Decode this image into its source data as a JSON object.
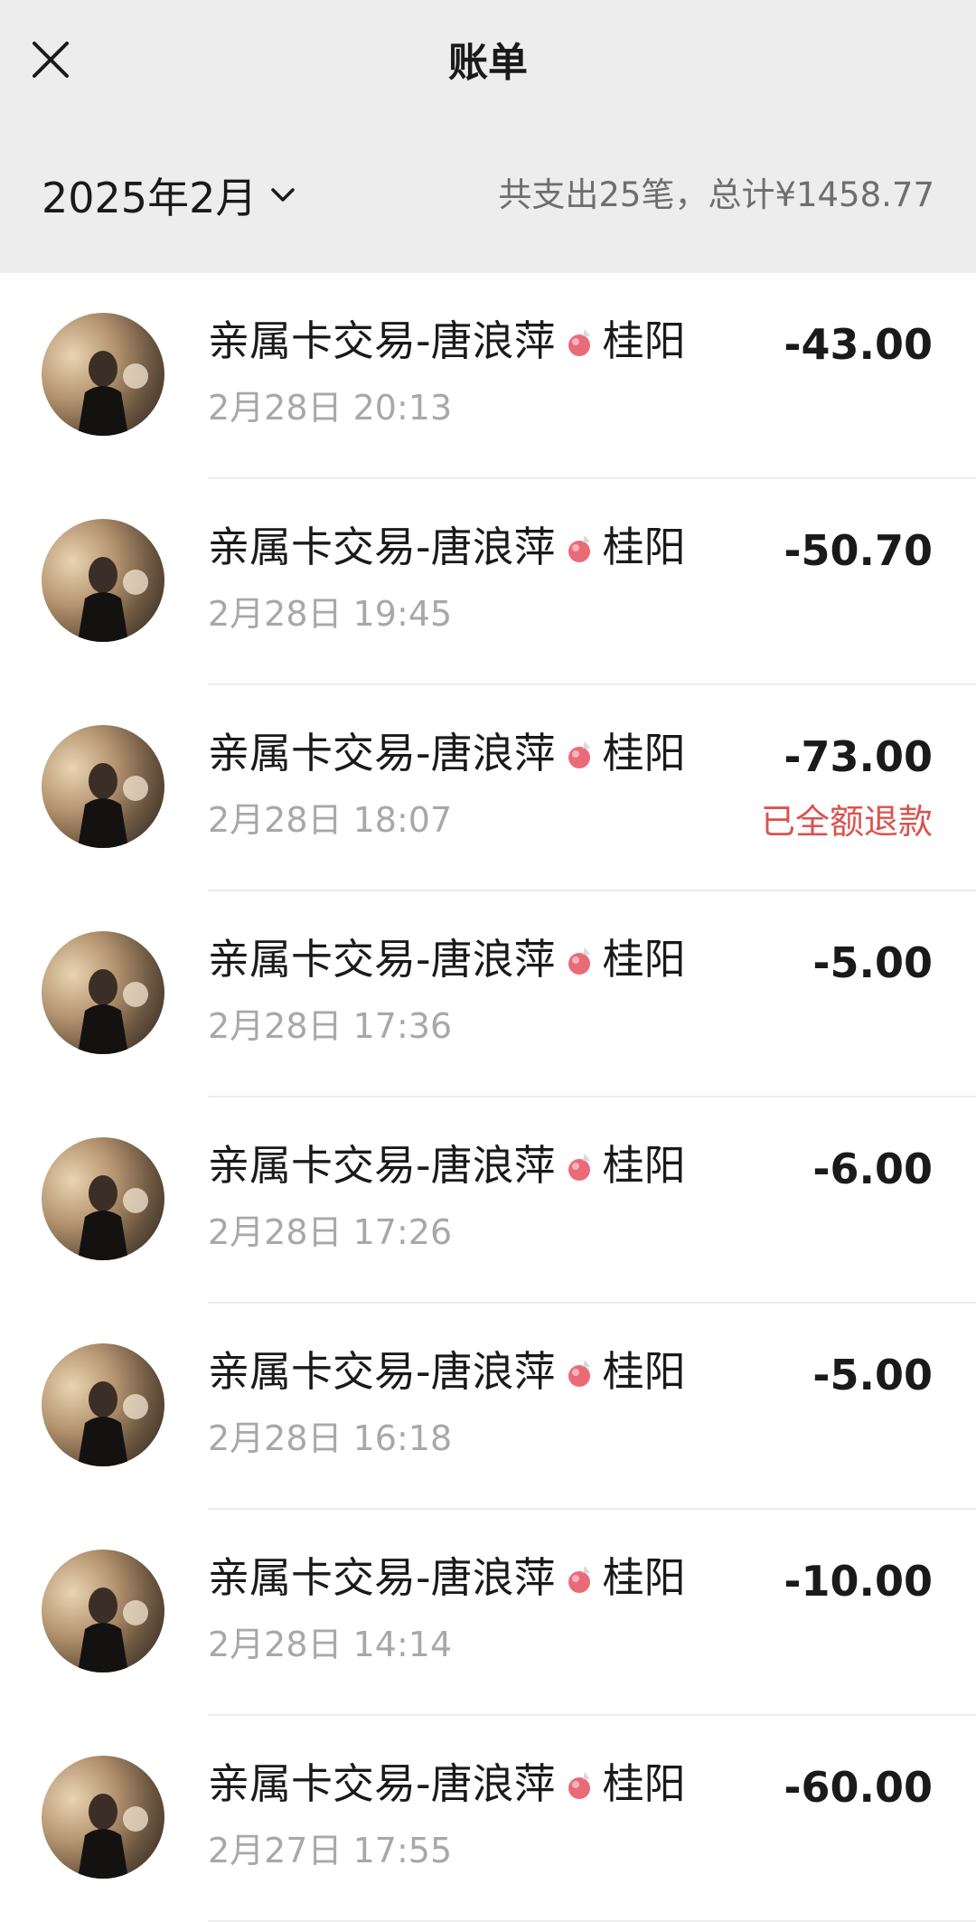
{
  "header": {
    "title": "账单",
    "month": "2025年2月",
    "summary": "共支出25笔，总计¥1458.77"
  },
  "colors": {
    "header_bg": "#ededed",
    "refund_text": "#d9534f",
    "secondary_text": "#a8a8a8"
  },
  "transactions": [
    {
      "name": "亲属卡交易-唐浪萍",
      "location": "桂阳",
      "time": "2月28日 20:13",
      "amount": "-43.00",
      "status": ""
    },
    {
      "name": "亲属卡交易-唐浪萍",
      "location": "桂阳",
      "time": "2月28日 19:45",
      "amount": "-50.70",
      "status": ""
    },
    {
      "name": "亲属卡交易-唐浪萍",
      "location": "桂阳",
      "time": "2月28日 18:07",
      "amount": "-73.00",
      "status": "已全额退款"
    },
    {
      "name": "亲属卡交易-唐浪萍",
      "location": "桂阳",
      "time": "2月28日 17:36",
      "amount": "-5.00",
      "status": ""
    },
    {
      "name": "亲属卡交易-唐浪萍",
      "location": "桂阳",
      "time": "2月28日 17:26",
      "amount": "-6.00",
      "status": ""
    },
    {
      "name": "亲属卡交易-唐浪萍",
      "location": "桂阳",
      "time": "2月28日 16:18",
      "amount": "-5.00",
      "status": ""
    },
    {
      "name": "亲属卡交易-唐浪萍",
      "location": "桂阳",
      "time": "2月28日 14:14",
      "amount": "-10.00",
      "status": ""
    },
    {
      "name": "亲属卡交易-唐浪萍",
      "location": "桂阳",
      "time": "2月27日 17:55",
      "amount": "-60.00",
      "status": ""
    }
  ]
}
